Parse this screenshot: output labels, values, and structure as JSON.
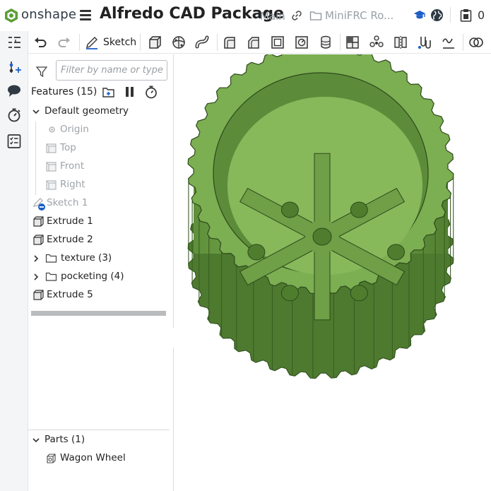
{
  "header": {
    "brand": "onshape",
    "document_title": "Alfredo CAD Package",
    "branch": "Main",
    "folder": "MiniFRC Ro...",
    "clipboard_count": "0",
    "brand_color": "#5b9e35"
  },
  "toolbar": {
    "sketch_label": "Sketch",
    "tools": [
      "undo-icon",
      "redo-icon",
      "sketch-pencil-icon",
      "extrude-icon",
      "revolve-icon",
      "sweep-icon",
      "fillet-icon",
      "chamfer-icon",
      "shell-icon",
      "hole-icon",
      "thread-icon",
      "boolean-icon",
      "pattern-icon",
      "mirror-icon",
      "mate-icon",
      "curve-icon",
      "view-icon"
    ]
  },
  "rail": {
    "items": [
      "feature-list-icon",
      "add-feature-icon",
      "comment-icon",
      "history-timer-icon",
      "checklist-icon"
    ]
  },
  "feature_panel": {
    "filter_placeholder": "Filter by name or type",
    "features_title": "Features (15)",
    "default_geometry_label": "Default geometry",
    "origin_label": "Origin",
    "planes": [
      "Top",
      "Front",
      "Right"
    ],
    "sketch_label": "Sketch 1",
    "extrude1": "Extrude 1",
    "extrude2": "Extrude 2",
    "folder_texture": "texture (3)",
    "folder_pocketing": "pocketing (4)",
    "extrude5": "Extrude 5",
    "parts_title": "Parts (1)",
    "part_name": "Wagon Wheel"
  },
  "model": {
    "name": "Wagon Wheel",
    "color": "#7cae52",
    "dark_color": "#4d7a2f",
    "tooth_count": 40,
    "spoke_count": 6
  }
}
